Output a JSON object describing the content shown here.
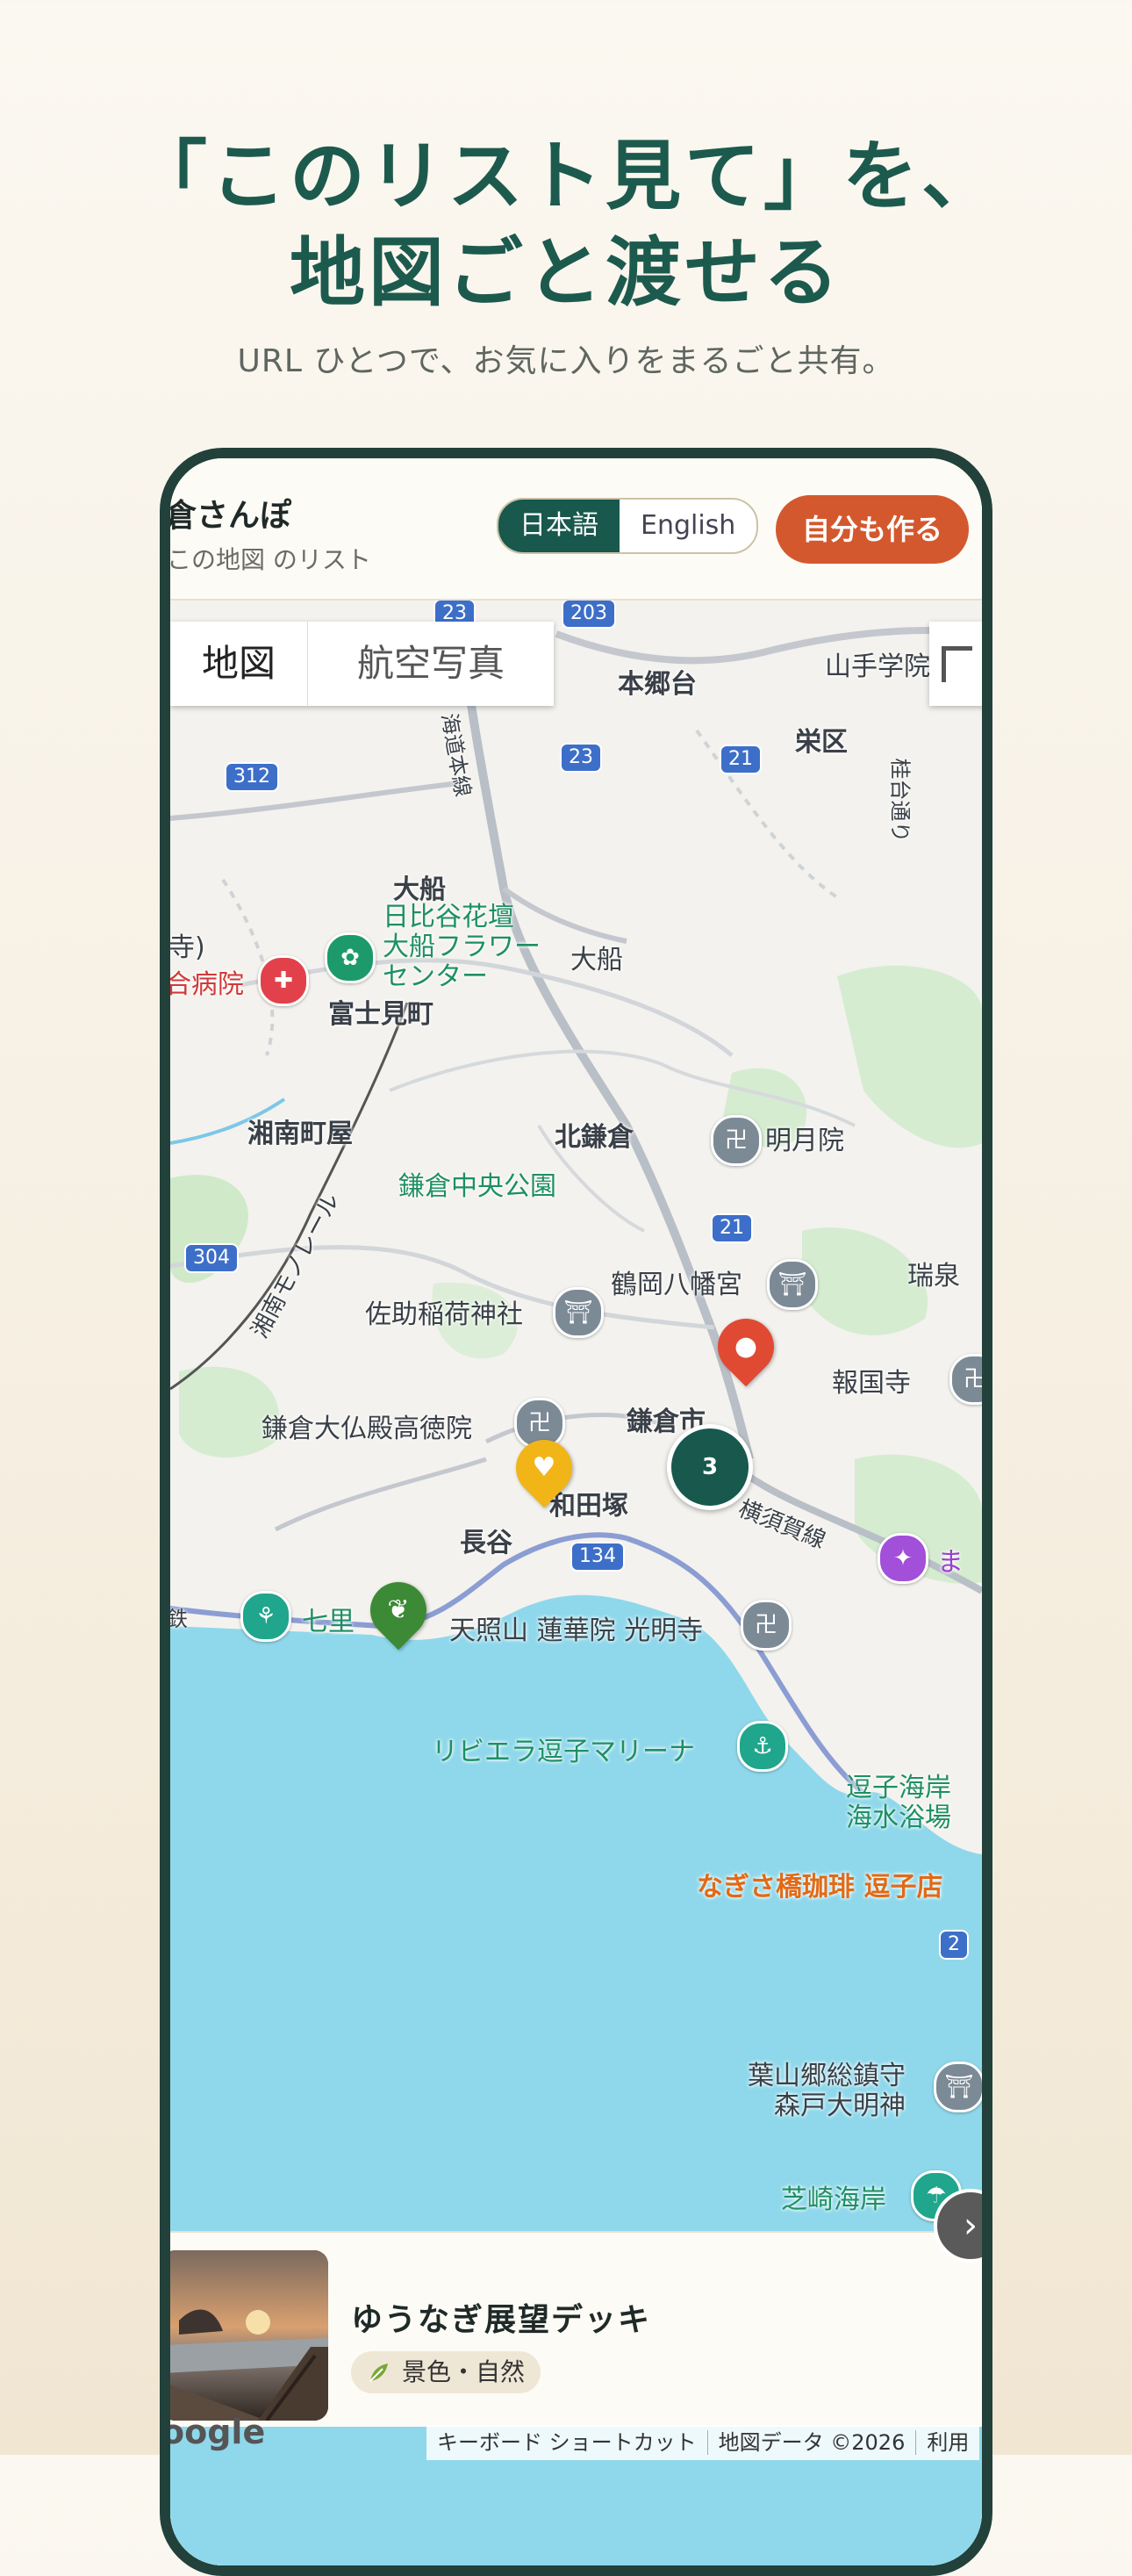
{
  "headline": {
    "line1": "「このリスト見て」を、",
    "line2": "地図ごと渡せる"
  },
  "subheadline": "URL ひとつで、お気に入りをまるごと共有。",
  "appbar": {
    "title": "倉さんぽ",
    "subtitle": "この地図 のリスト",
    "lang_ja": "日本語",
    "lang_en": "English",
    "create_button": "自分も作る"
  },
  "map": {
    "toggle_map": "地図",
    "toggle_satellite": "航空写真",
    "cluster_count": "3",
    "labels": {
      "hongodai": "本郷台",
      "yamate": "山手学院",
      "sakae": "栄区",
      "kazura": "桂台通り",
      "ofuna_station": "大船",
      "ofuna": "大船",
      "flower_center": "日比谷花壇\n大船フラワー\nセンター",
      "hospital": "合病院",
      "tera": "寺)",
      "fujimicho": "富士見町",
      "shonan_machiya": "湘南町屋",
      "monorail": "湘南モノレール",
      "kitakamakura": "北鎌倉",
      "meigetsuin": "明月院",
      "central_park": "鎌倉中央公園",
      "tsurugaoka": "鶴岡八幡宮",
      "zuisenji": "瑞泉",
      "sasuke": "佐助稲荷神社",
      "hokokuji": "報国寺",
      "daibutsu": "鎌倉大仏殿高徳院",
      "kamakura_city": "鎌倉市",
      "wadazuka": "和田塚",
      "yokosuka_line": "横須賀線",
      "hase": "長谷",
      "shichirigahama": "七里",
      "komyoji": "天照山 蓮華院 光明寺",
      "ma": "ま",
      "zushi_marina": "リビエラ逗子マリーナ",
      "zushi_beach": "逗子海岸\n海水浴場",
      "nagisa": "なぎさ橋珈琲 逗子店",
      "hayama": "葉山郷総鎮守\n森戸大明神",
      "shibazaki": "芝崎海岸",
      "yokosuka_line_left": "鉄",
      "ofuna_line": "海道本線"
    },
    "roads": [
      "23",
      "203",
      "312",
      "23",
      "21",
      "21",
      "304",
      "134",
      "2"
    ]
  },
  "card": {
    "title": "ゆうなぎ展望デッキ",
    "category": "景色・自然"
  },
  "attribution": {
    "google": "oogle",
    "shortcuts": "キーボード ショートカット",
    "map_data": "地図データ ©2026",
    "terms": "利用"
  },
  "colors": {
    "brand_green": "#18584d",
    "accent_orange": "#d4582e",
    "sea": "#8fd8eb"
  }
}
